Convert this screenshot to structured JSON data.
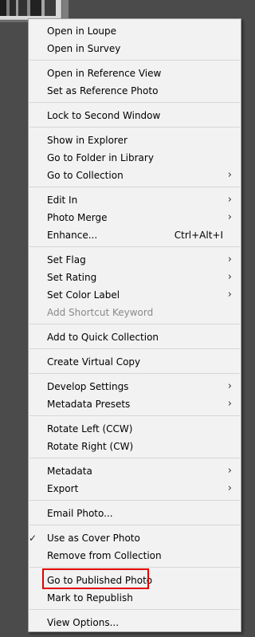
{
  "menu": {
    "items": [
      {
        "label": "Open in Loupe",
        "shortcut": "",
        "submenu": false,
        "disabled": false,
        "checked": false
      },
      {
        "label": "Open in Survey",
        "shortcut": "",
        "submenu": false,
        "disabled": false,
        "checked": false
      },
      {
        "label": "Open in Reference View",
        "shortcut": "",
        "submenu": false,
        "disabled": false,
        "checked": false
      },
      {
        "label": "Set as Reference Photo",
        "shortcut": "",
        "submenu": false,
        "disabled": false,
        "checked": false
      },
      {
        "label": "Lock to Second Window",
        "shortcut": "",
        "submenu": false,
        "disabled": false,
        "checked": false
      },
      {
        "label": "Show in Explorer",
        "shortcut": "",
        "submenu": false,
        "disabled": false,
        "checked": false
      },
      {
        "label": "Go to Folder in Library",
        "shortcut": "",
        "submenu": false,
        "disabled": false,
        "checked": false
      },
      {
        "label": "Go to Collection",
        "shortcut": "",
        "submenu": true,
        "disabled": false,
        "checked": false
      },
      {
        "label": "Edit In",
        "shortcut": "",
        "submenu": true,
        "disabled": false,
        "checked": false
      },
      {
        "label": "Photo Merge",
        "shortcut": "",
        "submenu": true,
        "disabled": false,
        "checked": false
      },
      {
        "label": "Enhance...",
        "shortcut": "Ctrl+Alt+I",
        "submenu": false,
        "disabled": false,
        "checked": false
      },
      {
        "label": "Set Flag",
        "shortcut": "",
        "submenu": true,
        "disabled": false,
        "checked": false
      },
      {
        "label": "Set Rating",
        "shortcut": "",
        "submenu": true,
        "disabled": false,
        "checked": false
      },
      {
        "label": "Set Color Label",
        "shortcut": "",
        "submenu": true,
        "disabled": false,
        "checked": false
      },
      {
        "label": "Add Shortcut Keyword",
        "shortcut": "",
        "submenu": false,
        "disabled": true,
        "checked": false
      },
      {
        "label": "Add to Quick Collection",
        "shortcut": "",
        "submenu": false,
        "disabled": false,
        "checked": false
      },
      {
        "label": "Create Virtual Copy",
        "shortcut": "",
        "submenu": false,
        "disabled": false,
        "checked": false
      },
      {
        "label": "Develop Settings",
        "shortcut": "",
        "submenu": true,
        "disabled": false,
        "checked": false
      },
      {
        "label": "Metadata Presets",
        "shortcut": "",
        "submenu": true,
        "disabled": false,
        "checked": false
      },
      {
        "label": "Rotate Left (CCW)",
        "shortcut": "",
        "submenu": false,
        "disabled": false,
        "checked": false
      },
      {
        "label": "Rotate Right (CW)",
        "shortcut": "",
        "submenu": false,
        "disabled": false,
        "checked": false
      },
      {
        "label": "Metadata",
        "shortcut": "",
        "submenu": true,
        "disabled": false,
        "checked": false
      },
      {
        "label": "Export",
        "shortcut": "",
        "submenu": true,
        "disabled": false,
        "checked": false
      },
      {
        "label": "Email Photo...",
        "shortcut": "",
        "submenu": false,
        "disabled": false,
        "checked": false
      },
      {
        "label": "Use as Cover Photo",
        "shortcut": "",
        "submenu": false,
        "disabled": false,
        "checked": true
      },
      {
        "label": "Remove from Collection",
        "shortcut": "",
        "submenu": false,
        "disabled": false,
        "checked": false
      },
      {
        "label": "Go to Published Photo",
        "shortcut": "",
        "submenu": false,
        "disabled": false,
        "checked": false
      },
      {
        "label": "Mark to Republish",
        "shortcut": "",
        "submenu": false,
        "disabled": false,
        "checked": false
      },
      {
        "label": "View Options...",
        "shortcut": "",
        "submenu": false,
        "disabled": false,
        "checked": false
      }
    ],
    "submenu_glyph": "›",
    "check_glyph": "✓"
  },
  "colors": {
    "menu_background": "#f2f2f2",
    "app_background": "#4b4b4b",
    "highlight_border": "#e10000",
    "disabled_text": "#8a8a8a"
  },
  "icons": {
    "submenu": "chevron-right-icon",
    "check": "checkmark-icon"
  }
}
